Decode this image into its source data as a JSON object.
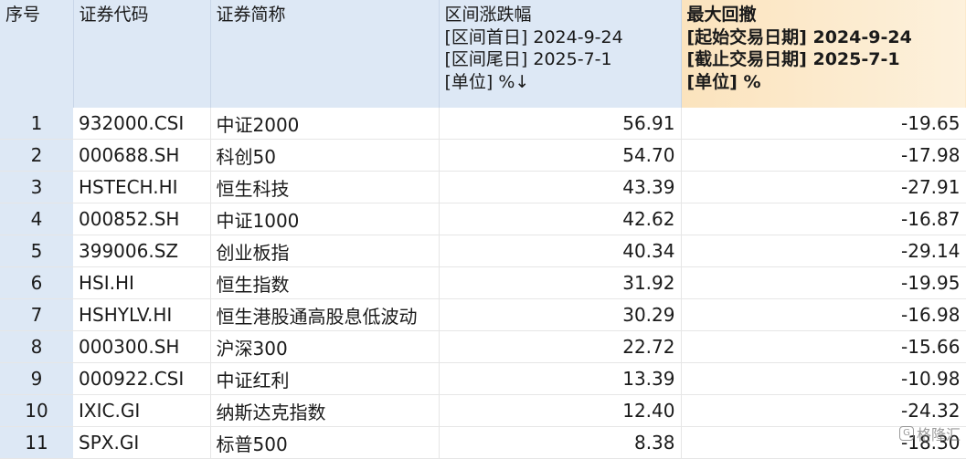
{
  "header": {
    "index": "序号",
    "code": "证券代码",
    "name": "证券简称",
    "range_change": {
      "title": "区间涨跌幅",
      "start": "[区间首日] 2024-9-24",
      "end": "[区间尾日] 2025-7-1",
      "unit": "[单位] %↓"
    },
    "max_drawdown": {
      "title": "最大回撤",
      "start": "[起始交易日期] 2024-9-24",
      "end": "[截止交易日期] 2025-7-1",
      "unit": "[单位] %"
    }
  },
  "rows": [
    {
      "idx": "1",
      "code": "932000.CSI",
      "name": "中证2000",
      "change": "56.91",
      "drawdown": "-19.65"
    },
    {
      "idx": "2",
      "code": "000688.SH",
      "name": "科创50",
      "change": "54.70",
      "drawdown": "-17.98"
    },
    {
      "idx": "3",
      "code": "HSTECH.HI",
      "name": "恒生科技",
      "change": "43.39",
      "drawdown": "-27.91"
    },
    {
      "idx": "4",
      "code": "000852.SH",
      "name": "中证1000",
      "change": "42.62",
      "drawdown": "-16.87"
    },
    {
      "idx": "5",
      "code": "399006.SZ",
      "name": "创业板指",
      "change": "40.34",
      "drawdown": "-29.14"
    },
    {
      "idx": "6",
      "code": "HSI.HI",
      "name": "恒生指数",
      "change": "31.92",
      "drawdown": "-19.95"
    },
    {
      "idx": "7",
      "code": "HSHYLV.HI",
      "name": "恒生港股通高股息低波动",
      "change": "30.29",
      "drawdown": "-16.98"
    },
    {
      "idx": "8",
      "code": "000300.SH",
      "name": "沪深300",
      "change": "22.72",
      "drawdown": "-15.66"
    },
    {
      "idx": "9",
      "code": "000922.CSI",
      "name": "中证红利",
      "change": "13.39",
      "drawdown": "-10.98"
    },
    {
      "idx": "10",
      "code": "IXIC.GI",
      "name": "纳斯达克指数",
      "change": "12.40",
      "drawdown": "-24.32"
    },
    {
      "idx": "11",
      "code": "SPX.GI",
      "name": "标普500",
      "change": "8.38",
      "drawdown": "-18.30"
    }
  ],
  "watermark": {
    "text": "格隆汇",
    "icon": "logo-icon"
  }
}
